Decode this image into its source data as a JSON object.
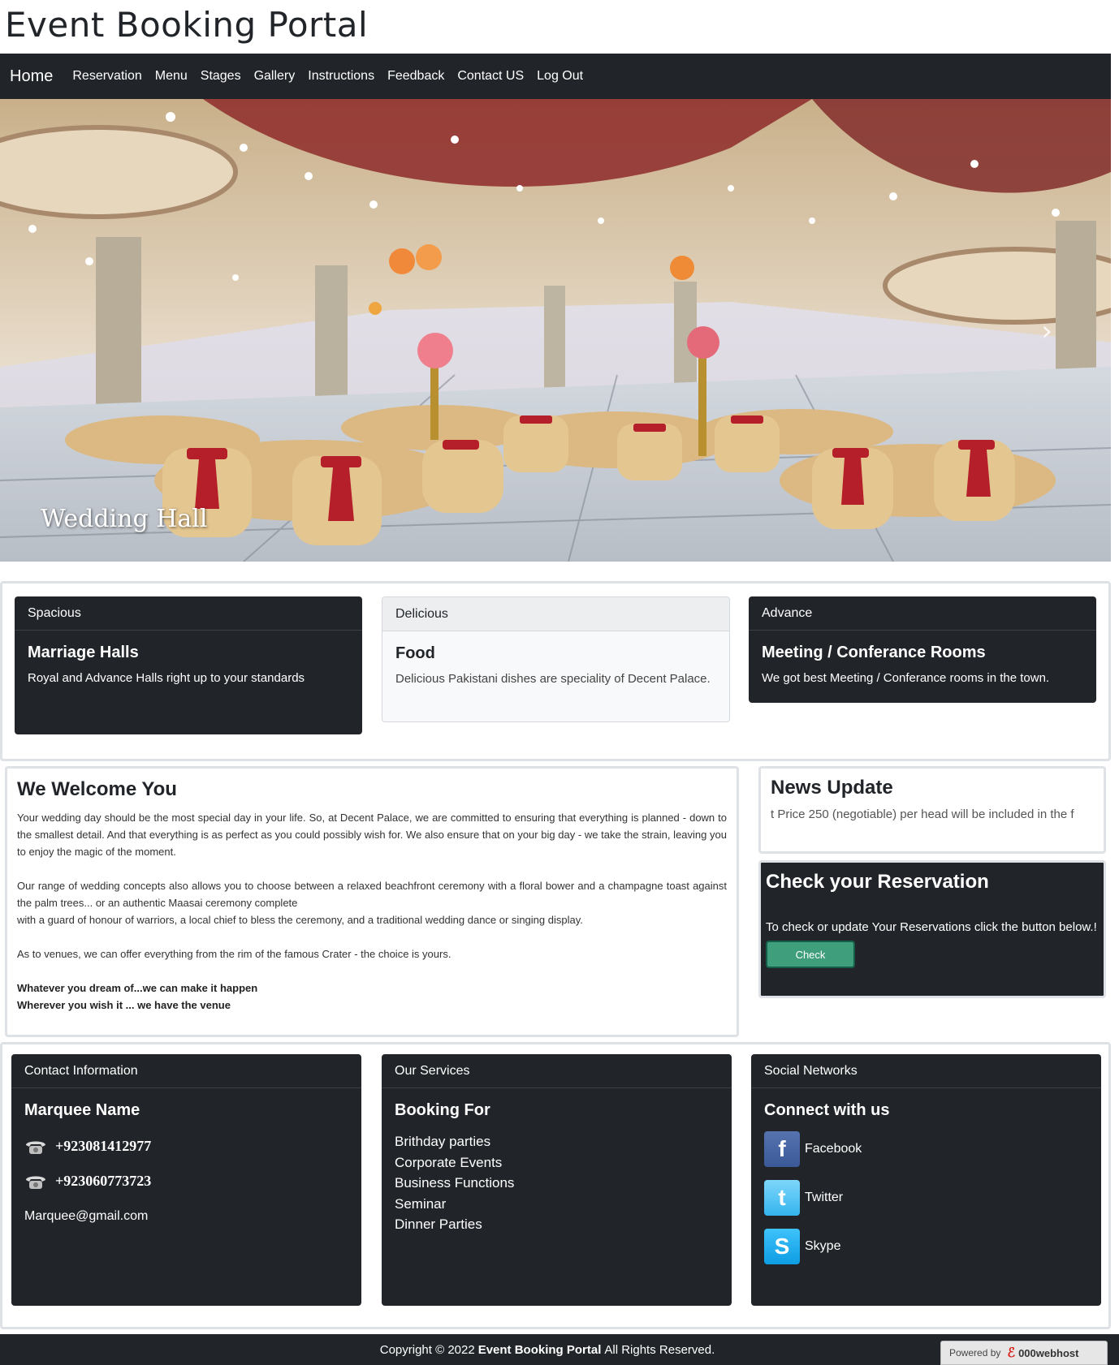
{
  "site": {
    "title": "Event Booking Portal"
  },
  "nav": {
    "brand": "Home",
    "links": [
      "Reservation",
      "Menu",
      "Stages",
      "Gallery",
      "Instructions",
      "Feedback",
      "Contact US",
      "Log Out"
    ]
  },
  "hero": {
    "caption": "Wedding Hall",
    "next_glyph": "›"
  },
  "features": [
    {
      "header": "Spacious",
      "title": "Marriage Halls",
      "text": "Royal and Advance Halls right up to your standards"
    },
    {
      "header": "Delicious",
      "title": "Food",
      "text": "Delicious Pakistani dishes are speciality of Decent Palace."
    },
    {
      "header": "Advance",
      "title": "Meeting / Conferance Rooms",
      "text": "We got best Meeting / Conferance rooms in the town."
    }
  ],
  "welcome": {
    "title": "We Welcome You",
    "para1": "Your wedding day should be the most special day in your life. So, at Decent Palace, we are committed to ensuring that everything is planned - down to the smallest detail. And that everything is as perfect as you could possibly wish for. We also ensure that on your big day - we take the strain, leaving you to enjoy the magic of the moment.",
    "para2a": "Our range of wedding concepts also allows you to choose between a relaxed beachfront ceremony with a floral bower and a champagne toast against the palm trees... or an authentic Maasai ceremony complete",
    "para2b": "with a guard of honour of warriors, a local chief to bless the ceremony, and a traditional wedding dance or singing display.",
    "para3": "As to venues, we can offer everything from the rim of the famous Crater - the choice is yours.",
    "bold1": "Whatever you dream of...we can make it happen",
    "bold2": "Wherever you wish it ... we have the venue"
  },
  "news": {
    "title": "News Update",
    "text": "t Price 250 (negotiable) per head will be included in the f"
  },
  "check": {
    "title": "Check your Reservation",
    "text": "To check or update Your Reservations click the button below.!",
    "button": "Check"
  },
  "contact": {
    "header": "Contact Information",
    "title": "Marquee Name",
    "phones": [
      "+923081412977",
      "+923060773723"
    ],
    "email": "Marquee@gmail.com"
  },
  "services": {
    "header": "Our Services",
    "title": "Booking For",
    "items": [
      "Brithday parties",
      "Corporate Events",
      "Business Functions",
      "Seminar",
      "Dinner Parties"
    ]
  },
  "social": {
    "header": "Social Networks",
    "title": "Connect with us",
    "items": [
      {
        "name": "Facebook",
        "icon": "facebook-icon",
        "color": "#3b5998"
      },
      {
        "name": "Twitter",
        "icon": "twitter-icon",
        "color": "#4fc3f7"
      },
      {
        "name": "Skype",
        "icon": "skype-icon",
        "color": "#12a5f4"
      }
    ]
  },
  "footer": {
    "prefix": "Copyright © 2022",
    "name": "Event Booking Portal",
    "suffix": "All Rights Reserved.",
    "powered_label": "Powered by",
    "powered_brand": "000webhost"
  },
  "colors": {
    "dark": "#212529",
    "accent_button": "#3f9f7c",
    "border": "#dee2e6"
  }
}
